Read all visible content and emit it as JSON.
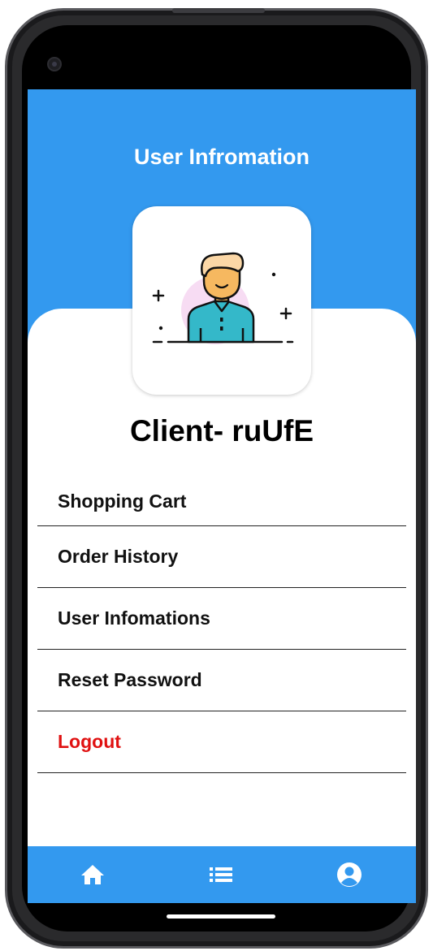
{
  "header": {
    "title": "User Infromation"
  },
  "profile": {
    "name": "Client- ruUfE",
    "avatar_icon": "user-avatar-icon"
  },
  "menu": {
    "items": [
      {
        "label": "Shopping Cart"
      },
      {
        "label": "Order History"
      },
      {
        "label": "User Infomations"
      },
      {
        "label": "Reset Password"
      },
      {
        "label": "Logout"
      }
    ]
  },
  "bottom_nav": {
    "items": [
      {
        "icon": "home-icon"
      },
      {
        "icon": "list-icon"
      },
      {
        "icon": "account-circle-icon"
      }
    ]
  },
  "colors": {
    "primary": "#3399ef",
    "logout": "#e01111",
    "text": "#111111"
  }
}
